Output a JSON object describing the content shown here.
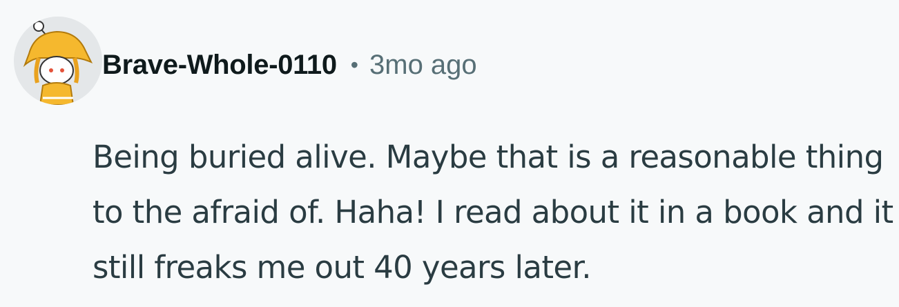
{
  "comment": {
    "author": "Brave-Whole-0110",
    "separator": "•",
    "time": "3mo ago",
    "body": "Being buried alive. Maybe that is a reasonable thing to the afraid of. Haha! I read about it in a book and it still freaks me out 40 years later."
  },
  "colors": {
    "background": "#f7f9fa",
    "author": "#0f1a1c",
    "meta": "#576f76",
    "text": "#2a3c42",
    "avatar_accent": "#f5b82e"
  },
  "icons": {
    "avatar": "snoo-avatar-yellow-hat-icon"
  }
}
